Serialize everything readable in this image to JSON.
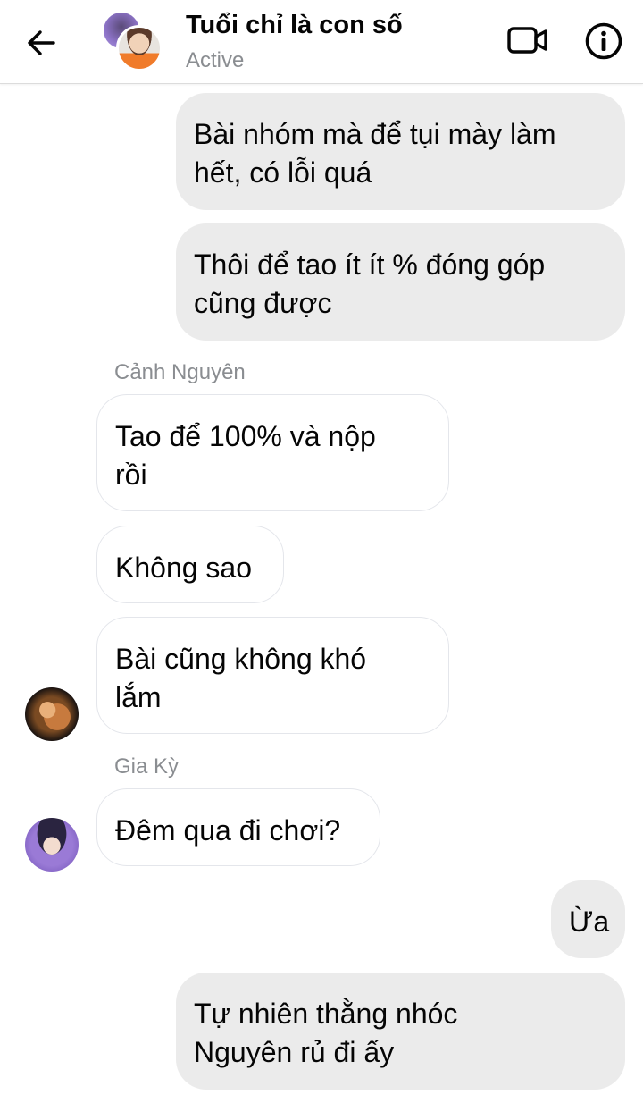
{
  "header": {
    "title": "Tuổi chỉ là con số",
    "status": "Active"
  },
  "messages": [
    {
      "side": "outgoing",
      "lines": [
        "Bài nhóm mà để tụi mày làm",
        "hết, có lỗi quá"
      ]
    },
    {
      "side": "outgoing",
      "lines": [
        "Thôi để tao ít ít % đóng góp",
        "cũng được"
      ]
    },
    {
      "sender": "Cảnh Nguyên"
    },
    {
      "side": "incoming",
      "lines": [
        "Tao để 100% và nộp",
        "rồi"
      ]
    },
    {
      "side": "incoming",
      "lines": [
        "Không sao"
      ]
    },
    {
      "side": "incoming",
      "lines": [
        "Bài cũng không khó",
        "lắm"
      ]
    },
    {
      "sender": "Gia Kỳ"
    },
    {
      "side": "incoming",
      "lines": [
        "Đêm qua đi chơi?"
      ]
    },
    {
      "side": "outgoing",
      "lines": [
        "Ừa"
      ]
    },
    {
      "side": "outgoing",
      "lines": [
        "Tự nhiên thằng nhóc",
        "Nguyên rủ đi ấy"
      ]
    }
  ],
  "icons": {
    "back": "arrow-left-icon",
    "video": "video-camera-icon",
    "info": "info-icon"
  },
  "colors": {
    "outgoing_bubble": "#ebebeb",
    "incoming_bubble_border": "#e4e6eb",
    "secondary_text": "#8a8d91"
  }
}
